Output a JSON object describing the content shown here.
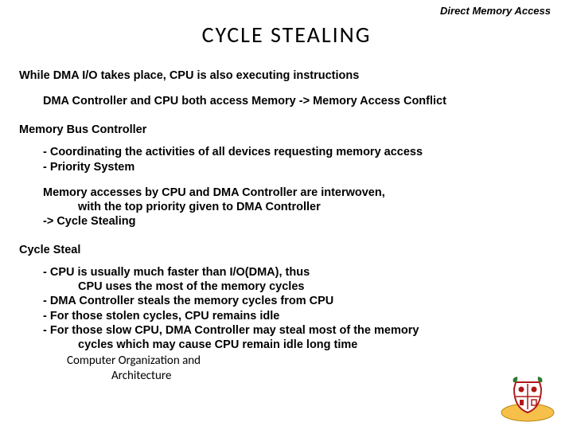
{
  "header": {
    "topic": "Direct Memory Access"
  },
  "title": "CYCLE  STEALING",
  "body": {
    "line1": "While DMA I/O takes place, CPU is also executing instructions",
    "line2": "DMA Controller and CPU both access Memory -> Memory Access Conflict",
    "sec1_heading": "Memory Bus Controller",
    "sec1_b1": "- Coordinating the activities of all devices requesting memory access",
    "sec1_b2": "- Priority System",
    "sec1_p1": "Memory accesses by CPU and DMA Controller are interwoven,",
    "sec1_p2": "with the top priority given to DMA Controller",
    "sec1_p3": "-> Cycle Stealing",
    "sec2_heading": "Cycle Steal",
    "sec2_b1a": "- CPU is usually much faster than I/O(DMA), thus",
    "sec2_b1b": "CPU uses the most of the memory cycles",
    "sec2_b2": "- DMA Controller steals the memory cycles from CPU",
    "sec2_b3": "- For those stolen cycles, CPU remains idle",
    "sec2_b4a": "- For those slow CPU, DMA Controller may steal most of the memory",
    "sec2_b4b": "cycles which may cause CPU remain idle long time"
  },
  "footer": {
    "course_l1": "Computer Organization and",
    "course_l2": "Architecture"
  }
}
